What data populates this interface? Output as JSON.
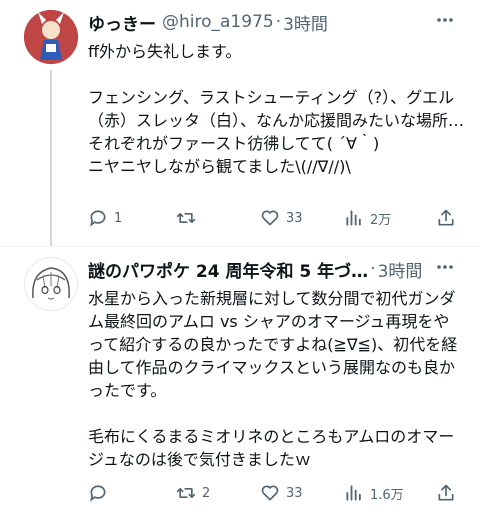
{
  "tweets": [
    {
      "name": "ゆっきー",
      "handle": "@hiro_a1975",
      "dot": "·",
      "time": "3時間",
      "text": "ff外から失礼します。\n\nフェンシング、ラストシューティング（?）、グエル（赤）スレッタ（白）、なんか応援間みたいな場所…\nそれぞれがファースト彷彿してて( ´∀｀)\nニヤニヤしながら観てました\\(//∇//)\\",
      "reply_count": "1",
      "retweet_count": "",
      "like_count": "33",
      "view_count": "2万"
    },
    {
      "name": "謎のパワポケ 24 周年令和 5 年づ…",
      "handle": "",
      "dot": "·",
      "time": "3時間",
      "text": "水星から入った新規層に対して数分間で初代ガンダム最終回のアムロ vs シャアのオマージュ再現をやって紹介するの良かったですよね(≧∇≦)、初代を経由して作品のクライマックスという展開なのも良かったです。\n\n毛布にくるまるミオリネのところもアムロのオマージュなのは後で気付きましたｗ",
      "reply_count": "",
      "retweet_count": "2",
      "like_count": "33",
      "view_count": "1.6万"
    }
  ],
  "colors": {
    "text": "#0f1419",
    "muted": "#536471",
    "thread_line": "#cfd9de"
  },
  "icons": [
    "more-icon",
    "reply-icon",
    "retweet-icon",
    "like-icon",
    "views-icon",
    "share-icon"
  ]
}
